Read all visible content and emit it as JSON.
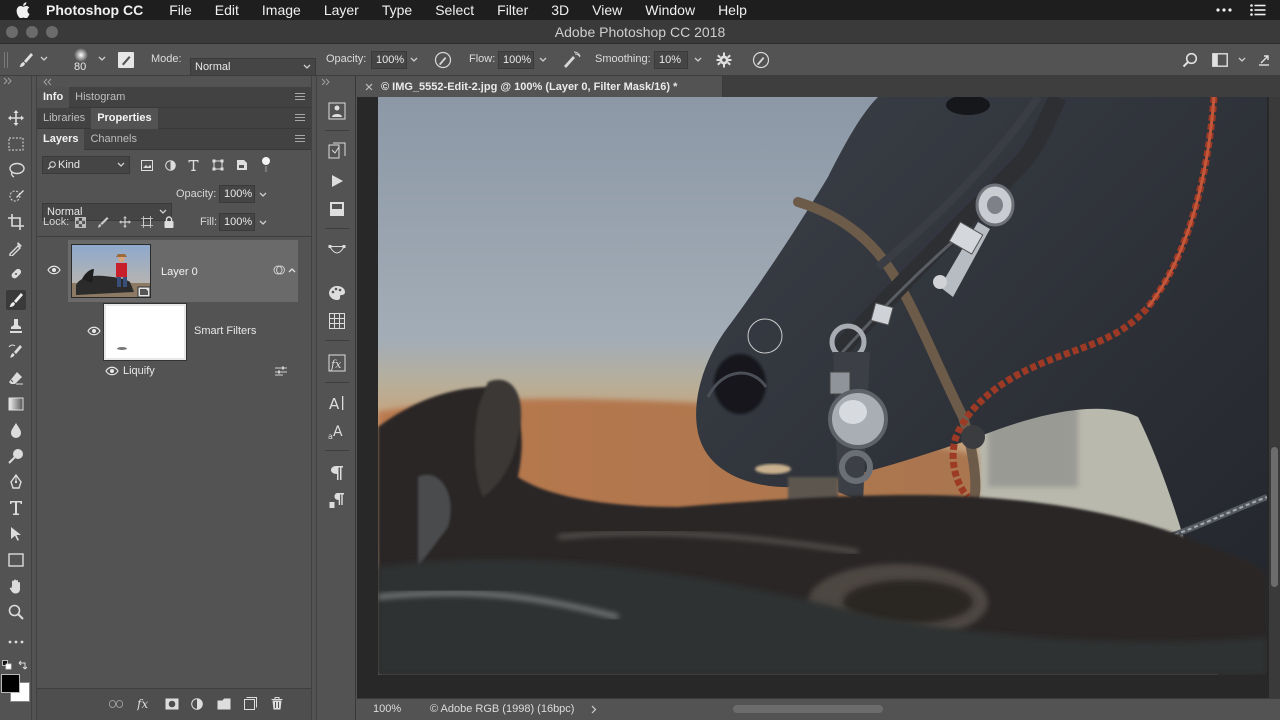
{
  "menubar": {
    "app": "Photoshop CC",
    "items": [
      "File",
      "Edit",
      "Image",
      "Layer",
      "Type",
      "Select",
      "Filter",
      "3D",
      "View",
      "Window",
      "Help"
    ]
  },
  "window": {
    "title": "Adobe Photoshop CC 2018"
  },
  "options": {
    "brush_size": "80",
    "mode_label": "Mode:",
    "mode_value": "Normal",
    "opacity_label": "Opacity:",
    "opacity_value": "100%",
    "flow_label": "Flow:",
    "flow_value": "100%",
    "smoothing_label": "Smoothing:",
    "smoothing_value": "10%"
  },
  "panels": {
    "row1": [
      "Info",
      "Histogram"
    ],
    "row2": [
      "Libraries",
      "Properties"
    ],
    "row3": [
      "Layers",
      "Channels"
    ]
  },
  "layers": {
    "filter_kind": "Kind",
    "blend_mode": "Normal",
    "opacity_label": "Opacity:",
    "opacity_value": "100%",
    "lock_label": "Lock:",
    "fill_label": "Fill:",
    "fill_value": "100%",
    "layer_name": "Layer 0",
    "smart_filters_label": "Smart Filters",
    "filter_name": "Liquify"
  },
  "document": {
    "tab_title": "© IMG_5552-Edit-2.jpg @ 100% (Layer 0, Filter Mask/16) *",
    "zoom": "100%",
    "color_profile": "© Adobe RGB (1998) (16bpc)"
  },
  "colors": {
    "chrome": "#535353",
    "panel_dark": "#424242",
    "canvas_bg": "#282828"
  }
}
